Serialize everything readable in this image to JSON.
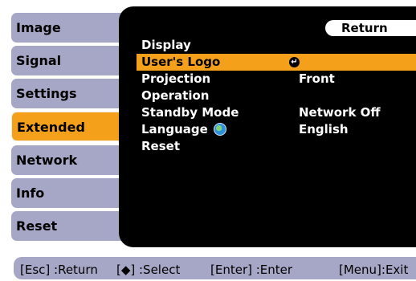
{
  "tabs": [
    {
      "label": "Image"
    },
    {
      "label": "Signal"
    },
    {
      "label": "Settings"
    },
    {
      "label": "Extended"
    },
    {
      "label": "Network"
    },
    {
      "label": "Info"
    },
    {
      "label": "Reset"
    }
  ],
  "active_tab": "Extended",
  "panel": {
    "return_label": "Return",
    "rows": [
      {
        "label": "Display",
        "value": ""
      },
      {
        "label": "User's Logo",
        "value": ""
      },
      {
        "label": "Projection",
        "value": "Front"
      },
      {
        "label": "Operation",
        "value": ""
      },
      {
        "label": "Standby Mode",
        "value": "Network Off"
      },
      {
        "label": "Language",
        "value": "English"
      },
      {
        "label": "Reset",
        "value": ""
      }
    ],
    "selected_row": "User's Logo"
  },
  "footer": {
    "esc": "[Esc] :Return",
    "select": "[◆] :Select",
    "enter": "[Enter] :Enter",
    "menu": "[Menu]:Exit"
  },
  "colors": {
    "tab_inactive": "#a6a6c6",
    "tab_active": "#f5a01a",
    "panel": "#000000",
    "row_selected": "#f5a01a"
  }
}
